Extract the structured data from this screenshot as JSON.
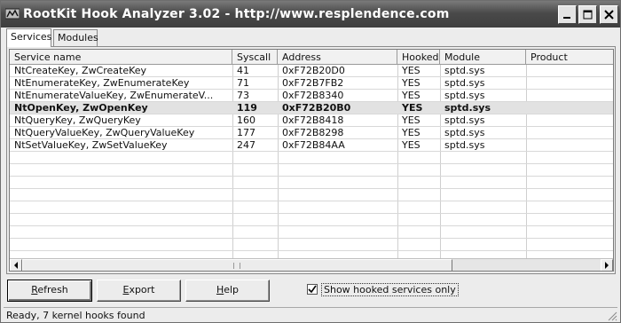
{
  "window": {
    "title": "RootKit Hook Analyzer 3.02 - http://www.resplendence.com",
    "controls": [
      "minimize",
      "maximize",
      "close"
    ]
  },
  "tabs": [
    {
      "label": "Services",
      "active": true
    },
    {
      "label": "Modules",
      "active": false
    }
  ],
  "table": {
    "columns": [
      "Service name",
      "Syscall",
      "Address",
      "Hooked",
      "Module",
      "Product"
    ],
    "rows": [
      {
        "service": "NtCreateKey, ZwCreateKey",
        "syscall": "41",
        "address": "0xF72B20D0",
        "hooked": "YES",
        "module": "sptd.sys",
        "product": "",
        "selected": false
      },
      {
        "service": "NtEnumerateKey, ZwEnumerateKey",
        "syscall": "71",
        "address": "0xF72B7FB2",
        "hooked": "YES",
        "module": "sptd.sys",
        "product": "",
        "selected": false
      },
      {
        "service": "NtEnumerateValueKey, ZwEnumerateV...",
        "syscall": "73",
        "address": "0xF72B8340",
        "hooked": "YES",
        "module": "sptd.sys",
        "product": "",
        "selected": false
      },
      {
        "service": "NtOpenKey, ZwOpenKey",
        "syscall": "119",
        "address": "0xF72B20B0",
        "hooked": "YES",
        "module": "sptd.sys",
        "product": "",
        "selected": true
      },
      {
        "service": "NtQueryKey, ZwQueryKey",
        "syscall": "160",
        "address": "0xF72B8418",
        "hooked": "YES",
        "module": "sptd.sys",
        "product": "",
        "selected": false
      },
      {
        "service": "NtQueryValueKey, ZwQueryValueKey",
        "syscall": "177",
        "address": "0xF72B8298",
        "hooked": "YES",
        "module": "sptd.sys",
        "product": "",
        "selected": false
      },
      {
        "service": "NtSetValueKey, ZwSetValueKey",
        "syscall": "247",
        "address": "0xF72B84AA",
        "hooked": "YES",
        "module": "sptd.sys",
        "product": "",
        "selected": false
      }
    ]
  },
  "buttons": {
    "refresh": {
      "label_first": "R",
      "label_rest": "efresh"
    },
    "export": {
      "label_first": "E",
      "label_rest": "xport"
    },
    "help": {
      "label_first": "H",
      "label_rest": "elp"
    }
  },
  "checkbox": {
    "label": "Show hooked services only",
    "checked": true
  },
  "status": {
    "text": "Ready, 7 kernel hooks found"
  },
  "colors": {
    "titlebar": "#4a4a4a",
    "selected_row": "#e2e2e2",
    "face": "#ececec"
  }
}
